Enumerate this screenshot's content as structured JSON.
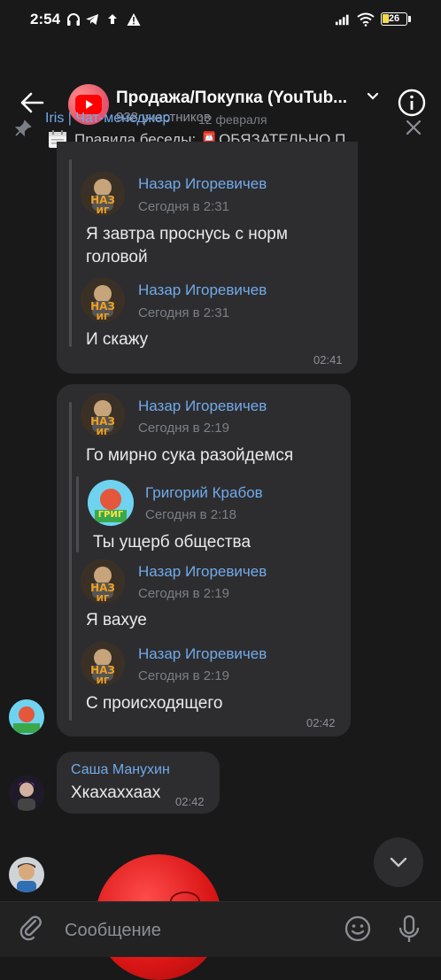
{
  "status": {
    "time": "2:54",
    "battery": "26"
  },
  "header": {
    "title": "Продажа/Покупка (YouTub...",
    "participants": "938 участников"
  },
  "pinned": {
    "author": "Iris | Чат-менеджер",
    "date": "12 февраля",
    "text": "Правила беседы: 📮ОБЯЗАТЕЛЬНО П..."
  },
  "messages": {
    "forward1": {
      "time": "02:41",
      "items": [
        {
          "author": "Назар Игоревичев",
          "date": "Сегодня в 2:31",
          "text": "Я завтра проснусь с норм головой"
        },
        {
          "author": "Назар Игоревичев",
          "date": "Сегодня в 2:31",
          "text": "И скажу"
        }
      ]
    },
    "forward2": {
      "time": "02:42",
      "items": [
        {
          "author": "Назар Игоревичев",
          "date": "Сегодня в 2:19",
          "text": "Го мирно сука разойдемся"
        },
        {
          "author": "Григорий Крабов",
          "date": "Сегодня в 2:18",
          "text": "Ты ущерб общества"
        },
        {
          "author": "Назар Игоревичев",
          "date": "Сегодня в 2:19",
          "text": "Я вахуе"
        },
        {
          "author": "Назар Игоревичев",
          "date": "Сегодня в 2:19",
          "text": "С происходящего"
        }
      ]
    },
    "sasha": {
      "author": "Саша Манухин",
      "text": "Хкахаххаах",
      "time": "02:42"
    }
  },
  "input": {
    "placeholder": "Сообщение"
  },
  "colors": {
    "background": "#19191a",
    "bubble": "#2d2d2f",
    "accent": "#71aaeb",
    "youtube_red": "#ff0000"
  },
  "icons": [
    "back-arrow-icon",
    "youtube-icon",
    "chevron-down-icon",
    "info-icon",
    "pin-icon",
    "calendar-icon",
    "close-icon",
    "scroll-down-icon",
    "attach-icon",
    "emoji-icon",
    "mic-icon"
  ]
}
